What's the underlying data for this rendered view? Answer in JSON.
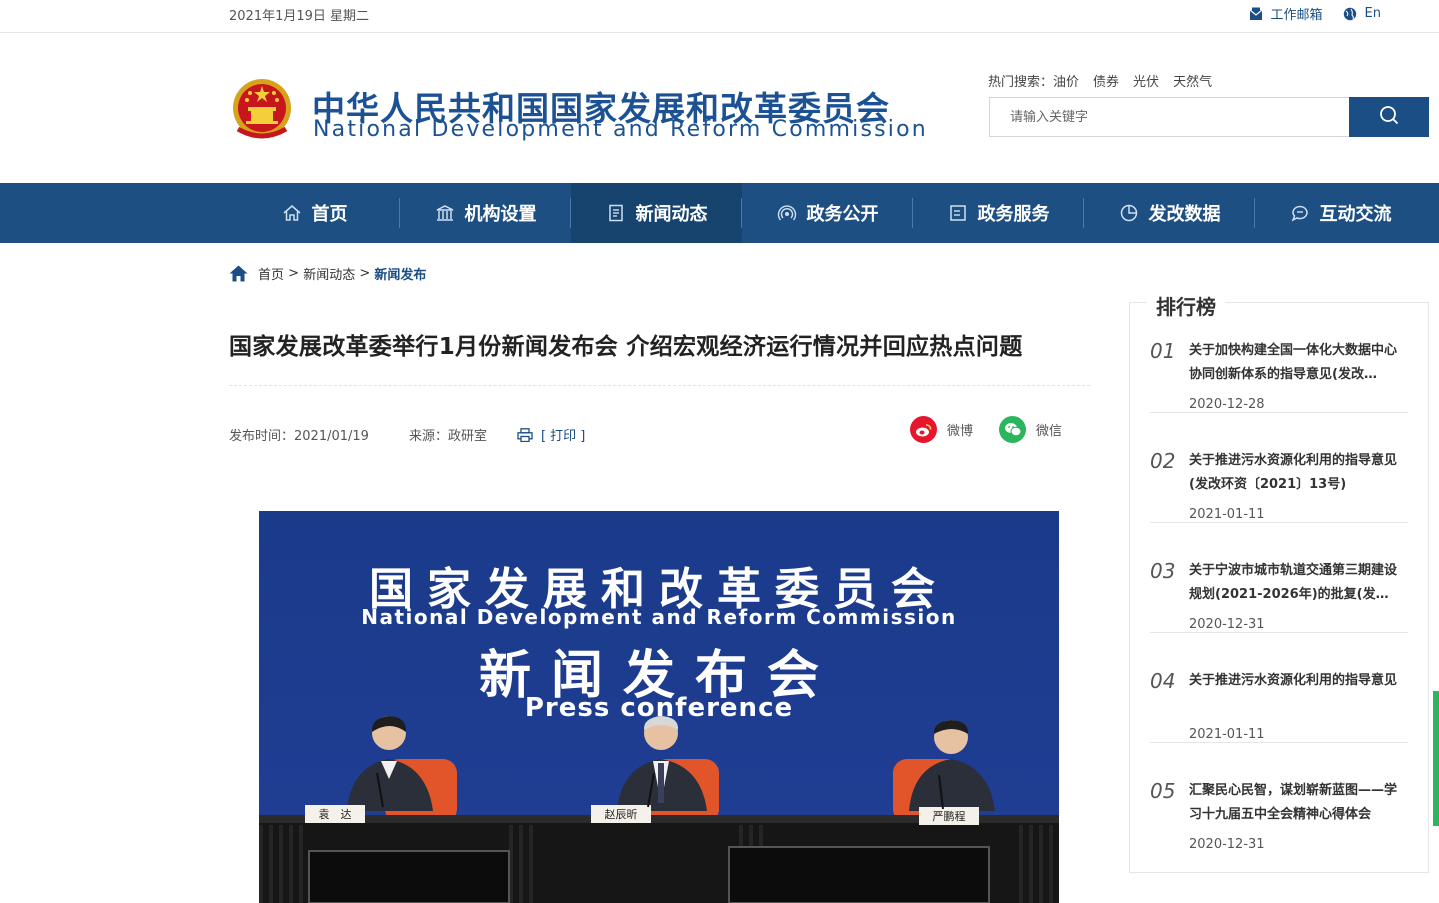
{
  "topbar": {
    "date": "2021年1月19日 星期二",
    "mail_label": "工作邮箱",
    "lang_label": "En"
  },
  "header": {
    "title_cn": "中华人民共和国国家发展和改革委员会",
    "title_en": "National Development and Reform Commission",
    "hot_label": "热门搜索：",
    "hot_words": [
      "油价",
      "债券",
      "光伏",
      "天然气"
    ],
    "search_placeholder": "请输入关键字"
  },
  "nav": {
    "items": [
      {
        "label": "首页",
        "icon": "home-icon"
      },
      {
        "label": "机构设置",
        "icon": "building-icon"
      },
      {
        "label": "新闻动态",
        "icon": "news-icon"
      },
      {
        "label": "政务公开",
        "icon": "broadcast-icon"
      },
      {
        "label": "政务服务",
        "icon": "list-icon"
      },
      {
        "label": "发改数据",
        "icon": "pie-chart-icon"
      },
      {
        "label": "互动交流",
        "icon": "chat-icon"
      }
    ],
    "active_index": 2
  },
  "breadcrumb": {
    "home": "首页",
    "sep1": " > ",
    "level1": "新闻动态",
    "sep2": " > ",
    "current": "新闻发布"
  },
  "article": {
    "title": "国家发展改革委举行1月份新闻发布会 介绍宏观经济运行情况并回应热点问题",
    "publish_time": "发布时间：2021/01/19",
    "source": "来源：政研室",
    "print_label": "[ 打印 ]",
    "share_weibo": "微博",
    "share_wechat": "微信"
  },
  "photo": {
    "backdrop_cn": "国家发展和改革委员会",
    "backdrop_en": "National Development and Reform Commission",
    "backdrop_pc": "新闻发布会",
    "backdrop_pc_en": "Press conference",
    "nameplates": [
      "袁　达",
      "赵辰昕",
      "严鹏程"
    ]
  },
  "ranking": {
    "title": "排行榜",
    "items": [
      {
        "num": "01",
        "text": "关于加快构建全国一体化大数据中心协同创新体系的指导意见(发改…",
        "date": "2020-12-28"
      },
      {
        "num": "02",
        "text": "关于推进污水资源化利用的指导意见(发改环资〔2021〕13号)",
        "date": "2021-01-11"
      },
      {
        "num": "03",
        "text": "关于宁波市城市轨道交通第三期建设规划(2021-2026年)的批复(发…",
        "date": "2020-12-31"
      },
      {
        "num": "04",
        "text": "关于推进污水资源化利用的指导意见",
        "date": "2021-01-11"
      },
      {
        "num": "05",
        "text": "汇聚民心民智，谋划崭新蓝图——学习十九届五中全会精神心得体会",
        "date": "2020-12-31"
      }
    ]
  },
  "colors": {
    "brand": "#1d4f83",
    "nav_active": "#17436f",
    "weibo": "#e6162d",
    "wechat": "#2bb55c"
  }
}
